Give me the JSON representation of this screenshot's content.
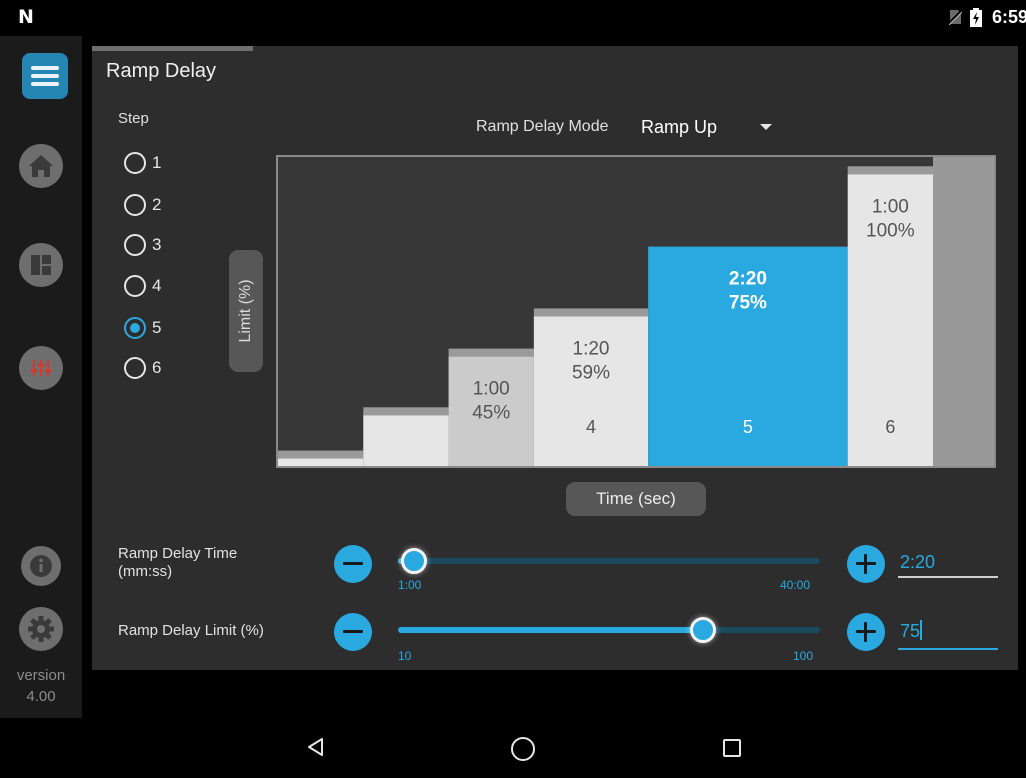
{
  "status_bar": {
    "time": "6:59",
    "icons": [
      "notification-n-icon",
      "no-sim-icon",
      "battery-charging-icon"
    ]
  },
  "sidebar": {
    "items": [
      {
        "name": "menu",
        "icon": "hamburger-menu-icon",
        "active": true
      },
      {
        "name": "home",
        "icon": "house-icon"
      },
      {
        "name": "dashboard",
        "icon": "grid-layout-icon"
      },
      {
        "name": "settings",
        "icon": "sliders-icon"
      },
      {
        "name": "info",
        "icon": "info-icon"
      },
      {
        "name": "system",
        "icon": "gear-icon"
      }
    ],
    "version_label": "version",
    "version_number": "4.00"
  },
  "page": {
    "title": "Ramp Delay",
    "step_label": "Step",
    "steps": [
      "1",
      "2",
      "3",
      "4",
      "5",
      "6"
    ],
    "selected_step": "5",
    "mode_label": "Ramp Delay Mode",
    "mode_value": "Ramp Up"
  },
  "chart_data": {
    "type": "bar",
    "xlabel": "Time (sec)",
    "ylabel": "Limit (%)",
    "ylim": [
      0,
      100
    ],
    "categories": [
      "1",
      "2",
      "3",
      "4",
      "5",
      "6"
    ],
    "step_labels": [
      "",
      "",
      "",
      "4",
      "5",
      "6"
    ],
    "values": [
      5,
      19,
      38,
      51,
      71,
      97
    ],
    "time_labels": [
      "",
      "",
      "1:00",
      "1:20",
      "2:20",
      "1:00"
    ],
    "percent_labels": [
      "",
      "",
      "45%",
      "59%",
      "75%",
      "100%"
    ],
    "durations_sec": [
      50,
      50,
      50,
      67,
      117,
      50
    ],
    "selected_index": 4,
    "colors": {
      "plot_bg": "#373737",
      "bar": "#e6e6e6",
      "bar_dim": "#cbcbcb",
      "cap": "#9a9a9a",
      "selected": "#2aa9e0",
      "tail": "#999999",
      "border": "#8a8a8a"
    }
  },
  "controls": {
    "time": {
      "label_line1": "Ramp Delay Time",
      "label_line2": "(mm:ss)",
      "min_label": "1:00",
      "max_label": "40:00",
      "min_sec": 60,
      "max_sec": 2400,
      "current_sec": 140,
      "value": "2:20"
    },
    "limit": {
      "label": "Ramp Delay Limit (%)",
      "min_label": "10",
      "max_label": "100",
      "min": 10,
      "max": 100,
      "current": 75,
      "value": "75"
    },
    "accent_color": "#2aa9e0"
  },
  "nav_bar": {
    "icons": [
      "back-triangle-icon",
      "home-circle-icon",
      "recents-square-icon"
    ]
  }
}
